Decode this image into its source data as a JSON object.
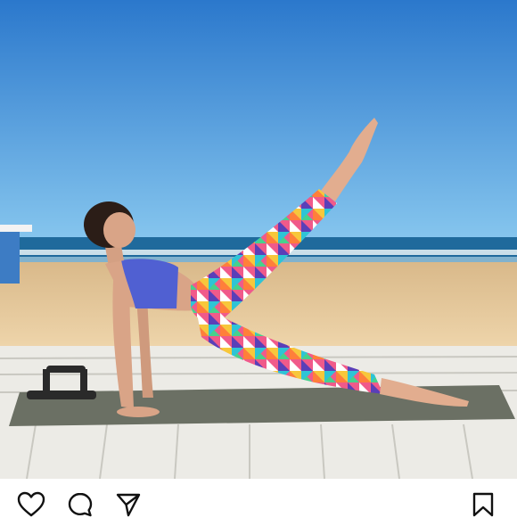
{
  "post": {
    "image": {
      "scene": "beach-yoga-photo",
      "colors": {
        "sky_top": "#2f80d1",
        "sky_bottom": "#7cc0ec",
        "sea": "#1f6fa0",
        "sand": "#e6c89a",
        "deck": "#f4f4f2",
        "mat": "#6e7366",
        "top": "#5564d6"
      }
    },
    "actions": {
      "like": "heart-icon",
      "comment": "comment-bubble-icon",
      "share": "paper-plane-icon",
      "save": "bookmark-icon"
    }
  }
}
